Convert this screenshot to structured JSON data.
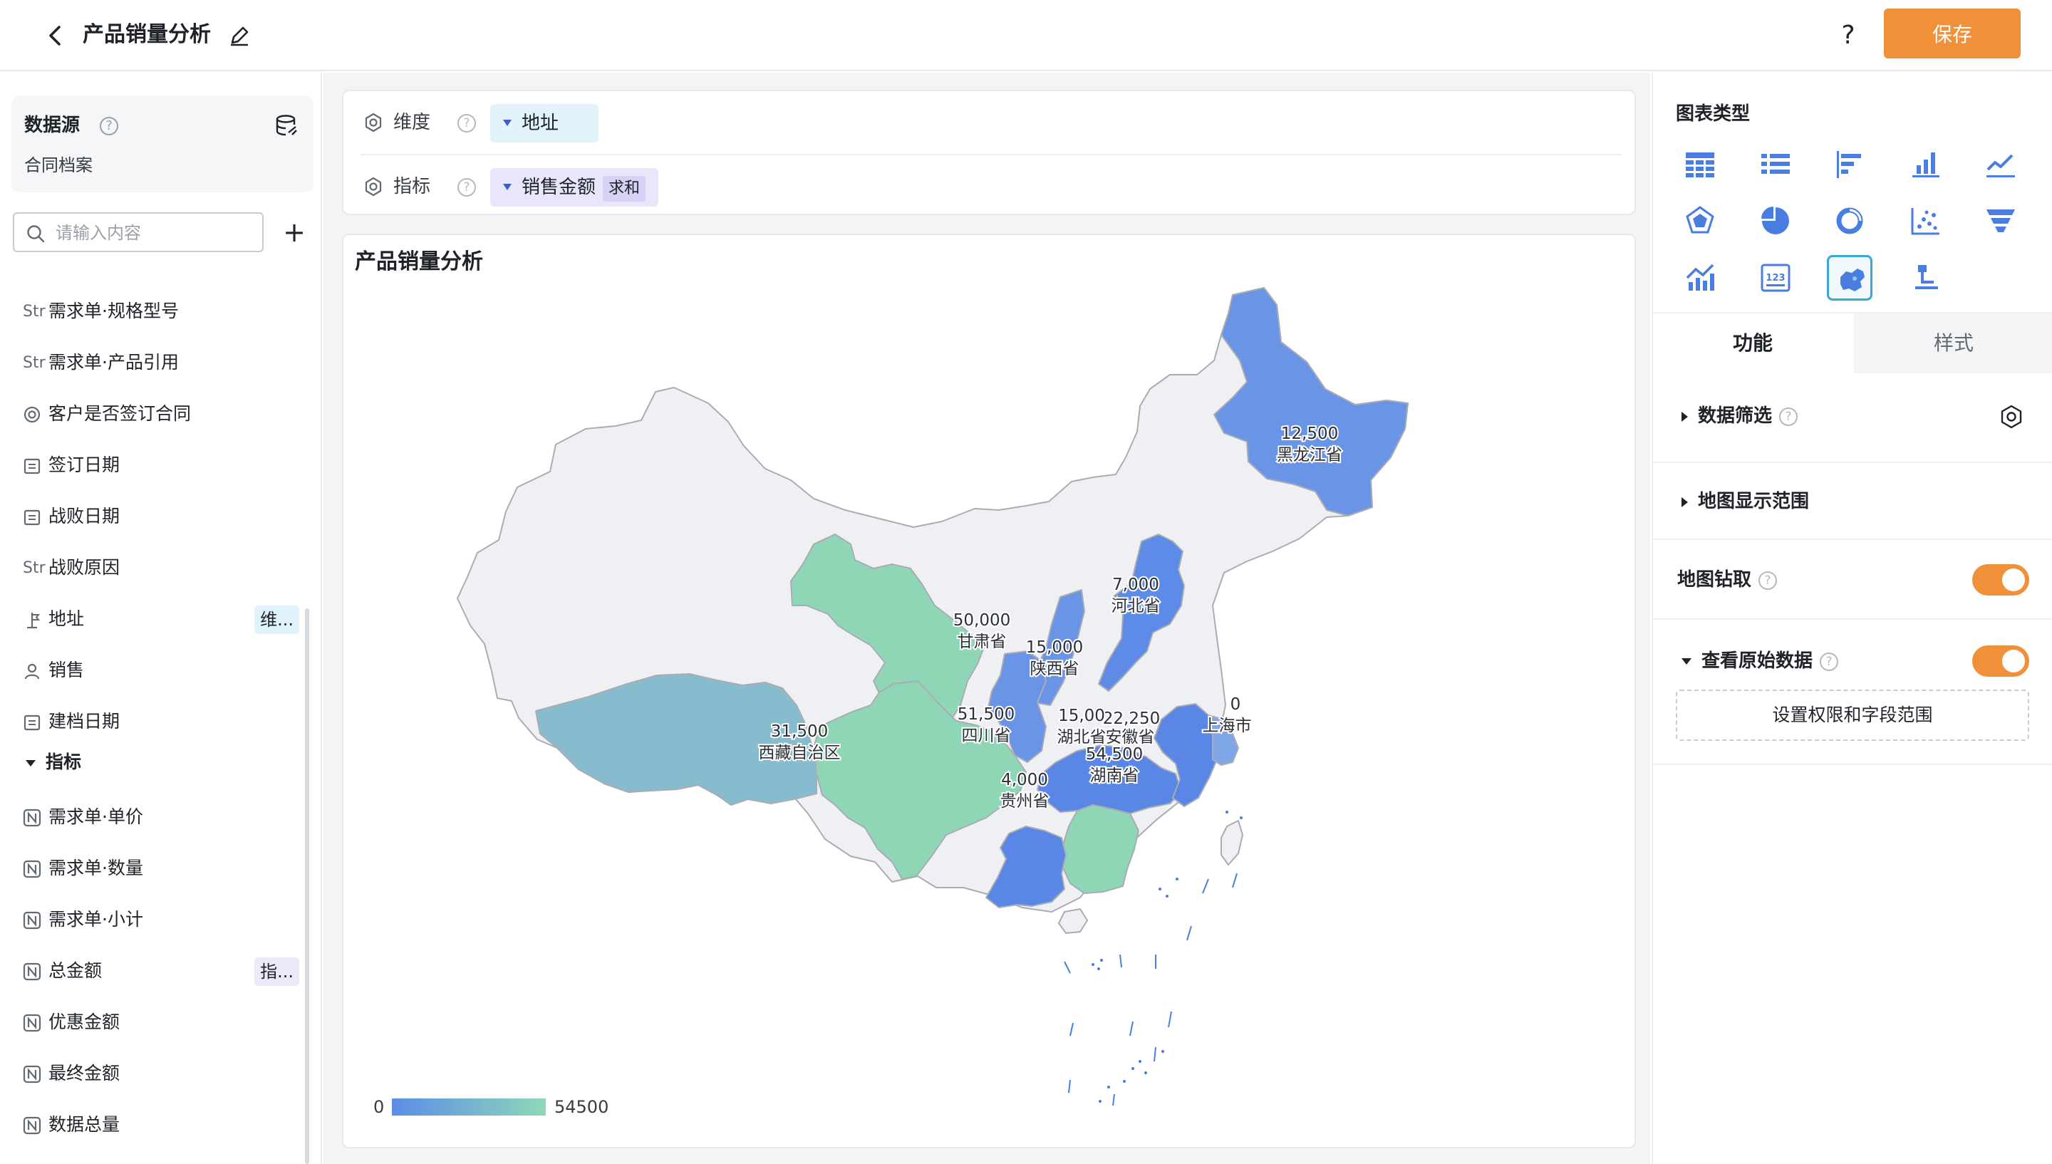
{
  "header": {
    "title": "产品销量分析",
    "help_label": "?",
    "save_label": "保存"
  },
  "left": {
    "datasource_title": "数据源",
    "help": "?",
    "datasource_name": "合同档案",
    "search_placeholder": "请输入内容",
    "add_label": "+",
    "fields": [
      {
        "icon": "Str",
        "label": "需求单·规格型号"
      },
      {
        "icon": "Str",
        "label": "需求单·产品引用"
      },
      {
        "icon": "radio-icon",
        "label": "客户是否签订合同"
      },
      {
        "icon": "calendar-icon",
        "label": "签订日期"
      },
      {
        "icon": "calendar-icon",
        "label": "战败日期"
      },
      {
        "icon": "Str",
        "label": "战败原因"
      },
      {
        "icon": "location-icon",
        "label": "地址",
        "badge": "维..."
      },
      {
        "icon": "user-icon",
        "label": "销售"
      },
      {
        "icon": "calendar-icon",
        "label": "建档日期"
      }
    ],
    "metrics_group": "指标",
    "metrics": [
      {
        "icon": "N",
        "label": "需求单·单价"
      },
      {
        "icon": "N",
        "label": "需求单·数量"
      },
      {
        "icon": "N",
        "label": "需求单·小计"
      },
      {
        "icon": "N",
        "label": "总金额",
        "badge": "指..."
      },
      {
        "icon": "N",
        "label": "优惠金额"
      },
      {
        "icon": "N",
        "label": "最终金额"
      },
      {
        "icon": "N",
        "label": "数据总量"
      }
    ]
  },
  "config": {
    "dimension_label": "维度",
    "dimension_value": "地址",
    "metric_label": "指标",
    "metric_value": "销售金额",
    "metric_agg": "求和",
    "help": "?"
  },
  "chart_data": {
    "type": "choropleth-map",
    "title": "产品销量分析",
    "regions": [
      {
        "name": "黑龙江省",
        "value": 12500,
        "label": "12,500"
      },
      {
        "name": "河北省",
        "value": 7000,
        "label": "7,000"
      },
      {
        "name": "甘肃省",
        "value": 50000,
        "label": "50,000"
      },
      {
        "name": "陕西省",
        "value": 15000,
        "label": "15,000"
      },
      {
        "name": "西藏自治区",
        "value": 31500,
        "label": "31,500"
      },
      {
        "name": "四川省",
        "value": 51500,
        "label": "51,500"
      },
      {
        "name": "湖北省",
        "value": 15000,
        "label": "15,00"
      },
      {
        "name": "安徽省",
        "value": 22250,
        "label": "22,250"
      },
      {
        "name": "上海市",
        "value": null,
        "label": "0"
      },
      {
        "name": "湖南省",
        "value": 54500,
        "label": "54,500"
      },
      {
        "name": "贵州省",
        "value": 4000,
        "label": "4,000"
      }
    ],
    "legend": {
      "min": "0",
      "max": "54500",
      "color_min": "#5b8de8",
      "color_max": "#8ed8b7"
    }
  },
  "right": {
    "chart_type_title": "图表类型",
    "chart_types": [
      "table-icon",
      "list-icon",
      "bar-horizontal-icon",
      "bar-vertical-icon",
      "line-icon",
      "radar-icon",
      "pie-icon",
      "donut-icon",
      "scatter-icon",
      "funnel-icon",
      "combo-icon",
      "number-card-icon",
      "map-icon",
      "tree-icon"
    ],
    "active_chart_type": "map-icon",
    "tab_function": "功能",
    "tab_style": "样式",
    "filter_label": "数据筛选",
    "map_range_label": "地图显示范围",
    "drill_label": "地图钻取",
    "raw_data_label": "查看原始数据",
    "perm_button": "设置权限和字段范围",
    "accent_color": "#f0913a"
  }
}
